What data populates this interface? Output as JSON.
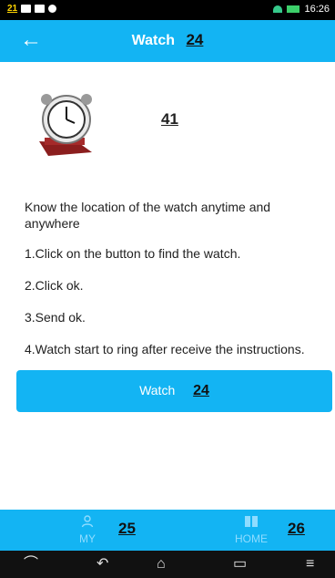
{
  "status_bar": {
    "left_badge": "21",
    "time": "16:26"
  },
  "app_bar": {
    "title": "Watch",
    "title_tag": "24"
  },
  "hero": {
    "icon": "alarm-clock-icon",
    "tag": "41"
  },
  "instructions": {
    "intro": "Know the location of the watch anytime and anywhere",
    "steps": [
      "1.Click on the button to find the watch.",
      "2.Click ok.",
      "3.Send ok.",
      "4.Watch start to ring after receive the instructions."
    ]
  },
  "find_button": {
    "label": "Watch",
    "tag": "24"
  },
  "bottom_nav": {
    "items": [
      {
        "label": "MY",
        "icon": "person-icon",
        "tag": "25"
      },
      {
        "label": "HOME",
        "icon": "book-icon",
        "tag": "26"
      }
    ]
  },
  "colors": {
    "primary": "#13b4f3",
    "inactive_tab": "#8fdcff"
  }
}
